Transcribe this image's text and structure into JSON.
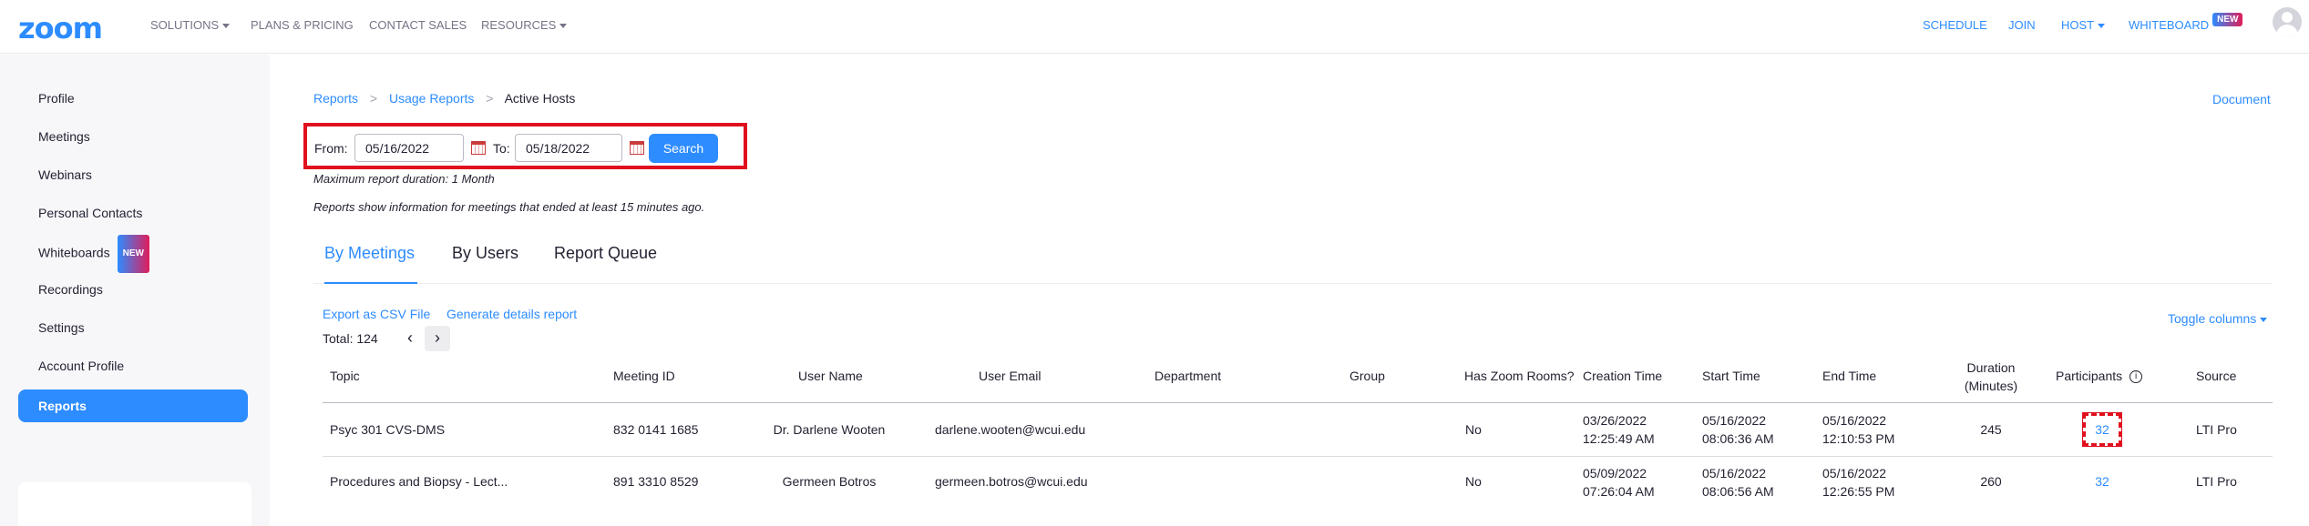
{
  "topnav": {
    "logo": "zoom",
    "solutions": "SOLUTIONS",
    "plans": "PLANS & PRICING",
    "contact_sales": "CONTACT SALES",
    "resources": "RESOURCES",
    "schedule": "SCHEDULE",
    "join": "JOIN",
    "host": "HOST",
    "whiteboard": "WHITEBOARD",
    "new_badge": "NEW"
  },
  "sidebar": {
    "items": [
      {
        "label": "Profile"
      },
      {
        "label": "Meetings"
      },
      {
        "label": "Webinars"
      },
      {
        "label": "Personal Contacts"
      },
      {
        "label": "Whiteboards",
        "badge": "NEW"
      },
      {
        "label": "Recordings"
      },
      {
        "label": "Settings"
      },
      {
        "label": "Account Profile"
      },
      {
        "label": "Reports"
      }
    ],
    "active": "Reports"
  },
  "breadcrumb": {
    "reports": "Reports",
    "usage_reports": "Usage Reports",
    "current": "Active Hosts",
    "separator": ">"
  },
  "document_link": "Document",
  "filter": {
    "from_label": "From:",
    "from_value": "05/16/2022",
    "to_label": "To:",
    "to_value": "05/18/2022",
    "search_label": "Search"
  },
  "notes": {
    "max_duration": "Maximum report duration: 1 Month",
    "info": "Reports show information for meetings that ended at least 15 minutes ago."
  },
  "tabs": [
    {
      "label": "By Meetings",
      "active": true
    },
    {
      "label": "By Users",
      "active": false
    },
    {
      "label": "Report Queue",
      "active": false
    }
  ],
  "actions": {
    "export_csv": "Export as CSV File",
    "generate_details": "Generate details report",
    "toggle_columns": "Toggle columns"
  },
  "pagination": {
    "total": "Total: 124",
    "prev": "‹",
    "next": "›"
  },
  "table": {
    "headers": {
      "topic": "Topic",
      "meeting_id": "Meeting ID",
      "user_name": "User Name",
      "user_email": "User Email",
      "department": "Department",
      "group": "Group",
      "has_zoom_rooms": "Has Zoom Rooms?",
      "creation_time": "Creation Time",
      "start_time": "Start Time",
      "end_time": "End Time",
      "duration_line1": "Duration",
      "duration_line2": "(Minutes)",
      "participants": "Participants",
      "source": "Source"
    },
    "rows": [
      {
        "topic": "Psyc 301 CVS-DMS",
        "meeting_id": "832 0141 1685",
        "user_name": "Dr. Darlene Wooten",
        "user_email": "darlene.wooten@wcui.edu",
        "department": "",
        "group": "",
        "has_zoom_rooms": "No",
        "creation_date": "03/26/2022",
        "creation_clock": "12:25:49 AM",
        "start_date": "05/16/2022",
        "start_clock": "08:06:36 AM",
        "end_date": "05/16/2022",
        "end_clock": "12:10:53 PM",
        "duration": "245",
        "participants": "32",
        "source": "LTI Pro"
      },
      {
        "topic": "Procedures and Biopsy - Lect...",
        "meeting_id": "891 3310 8529",
        "user_name": "Germeen Botros",
        "user_email": "germeen.botros@wcui.edu",
        "department": "",
        "group": "",
        "has_zoom_rooms": "No",
        "creation_date": "05/09/2022",
        "creation_clock": "07:26:04 AM",
        "start_date": "05/16/2022",
        "start_clock": "08:06:56 AM",
        "end_date": "05/16/2022",
        "end_clock": "12:26:55 PM",
        "duration": "260",
        "participants": "32",
        "source": "LTI Pro"
      }
    ]
  },
  "colors": {
    "accent": "#2d8cff",
    "highlight": "#e0101e"
  }
}
